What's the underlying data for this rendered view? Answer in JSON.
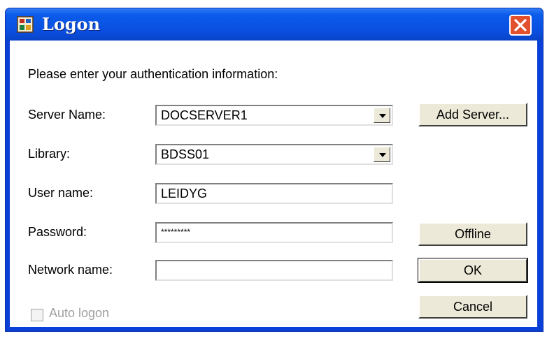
{
  "window": {
    "title": "Logon",
    "close_icon": "close-icon",
    "app_icon": "app-icon"
  },
  "prompt": "Please enter your authentication information:",
  "server": {
    "label": "Server Name:",
    "value": "DOCSERVER1"
  },
  "library": {
    "label": "Library:",
    "value": "BDSS01"
  },
  "username": {
    "label": "User name:",
    "value": "LEIDYG"
  },
  "password": {
    "label": "Password:",
    "value": "*********"
  },
  "network": {
    "label": "Network name:",
    "value": ""
  },
  "auto_logon": {
    "label": "Auto logon",
    "checked": false,
    "enabled": false
  },
  "buttons": {
    "add_server": "Add Server...",
    "offline": "Offline",
    "ok": "OK",
    "cancel": "Cancel"
  },
  "colors": {
    "titlebar": "#0a4fe0",
    "close": "#e2502d",
    "face": "#ece9d8"
  }
}
